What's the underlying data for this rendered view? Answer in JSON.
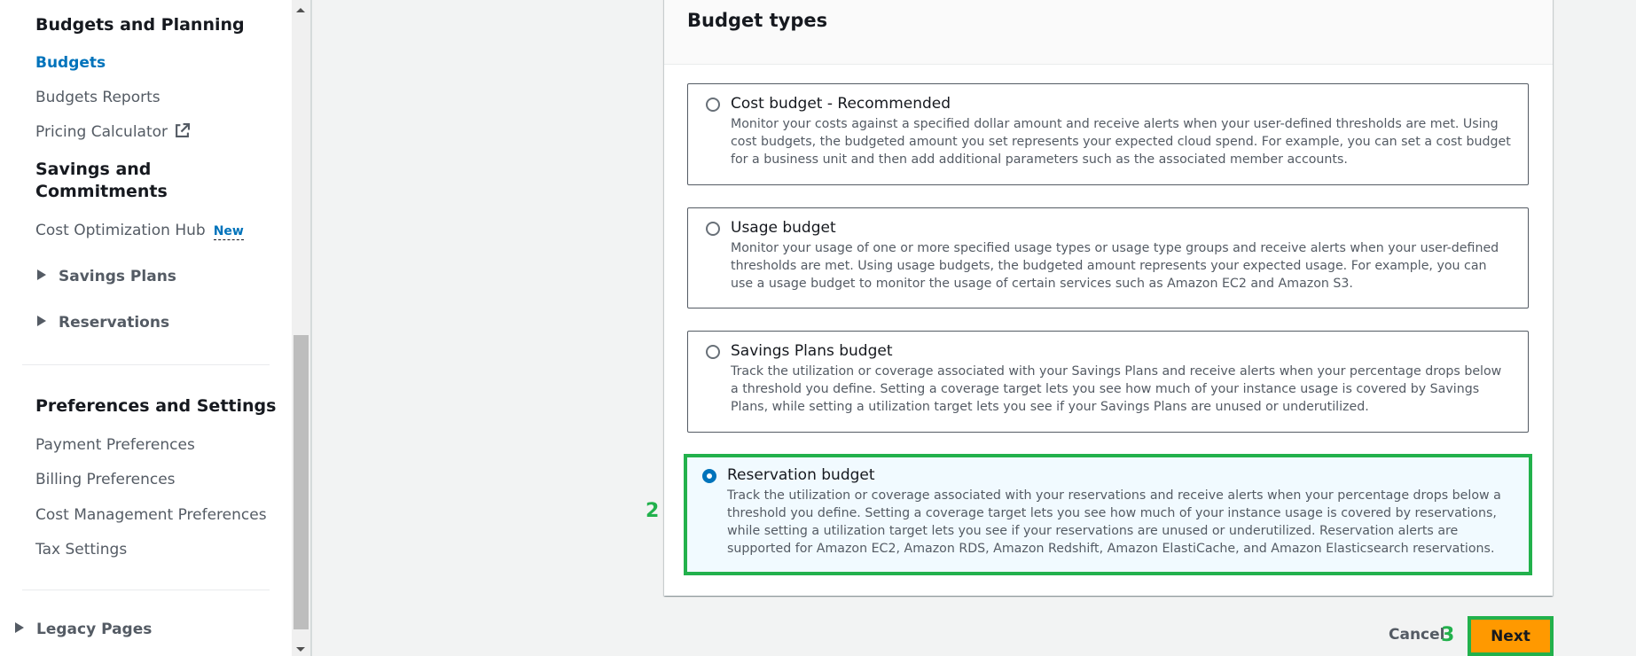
{
  "sidebar": {
    "section_budgets": "Budgets and Planning",
    "budgets": "Budgets",
    "budgets_reports": "Budgets Reports",
    "pricing_calculator": "Pricing Calculator",
    "section_savings_line1": "Savings and",
    "section_savings_line2": "Commitments",
    "cost_optimization_hub": "Cost Optimization Hub",
    "new_badge": "New",
    "savings_plans": "Savings Plans",
    "reservations": "Reservations",
    "section_preferences": "Preferences and Settings",
    "payment_preferences": "Payment Preferences",
    "billing_preferences": "Billing Preferences",
    "cost_management_preferences": "Cost Management Preferences",
    "tax_settings": "Tax Settings",
    "legacy_pages": "Legacy Pages"
  },
  "panel": {
    "title": "Budget types",
    "options": [
      {
        "label": "Cost budget - Recommended",
        "description": "Monitor your costs against a specified dollar amount and receive alerts when your user-defined thresholds are met. Using cost budgets, the budgeted amount you set represents your expected cloud spend. For example, you can set a cost budget for a business unit and then add additional parameters such as the associated member accounts.",
        "selected": false
      },
      {
        "label": "Usage budget",
        "description": "Monitor your usage of one or more specified usage types or usage type groups and receive alerts when your user-defined thresholds are met. Using usage budgets, the budgeted amount represents your expected usage. For example, you can use a usage budget to monitor the usage of certain services such as Amazon EC2 and Amazon S3.",
        "selected": false
      },
      {
        "label": "Savings Plans budget",
        "description": "Track the utilization or coverage associated with your Savings Plans and receive alerts when your percentage drops below a threshold you define. Setting a coverage target lets you see how much of your instance usage is covered by Savings Plans, while setting a utilization target lets you see if your Savings Plans are unused or underutilized.",
        "selected": false
      },
      {
        "label": "Reservation budget",
        "description": "Track the utilization or coverage associated with your reservations and receive alerts when your percentage drops below a threshold you define. Setting a coverage target lets you see how much of your instance usage is covered by reservations, while setting a utilization target lets you see if your reservations are unused or underutilized. Reservation alerts are supported for Amazon EC2, Amazon RDS, Amazon Redshift, Amazon ElastiCache, and Amazon Elasticsearch reservations.",
        "selected": true
      }
    ]
  },
  "annotations": {
    "step_2": "2",
    "step_3": "3"
  },
  "footer": {
    "cancel_label": "Cancel",
    "next_label": "Next"
  },
  "colors": {
    "accent_blue": "#0073bb",
    "primary_orange": "#ff9900",
    "annotation_green": "#22b14c",
    "selected_bg": "#f1faff"
  }
}
